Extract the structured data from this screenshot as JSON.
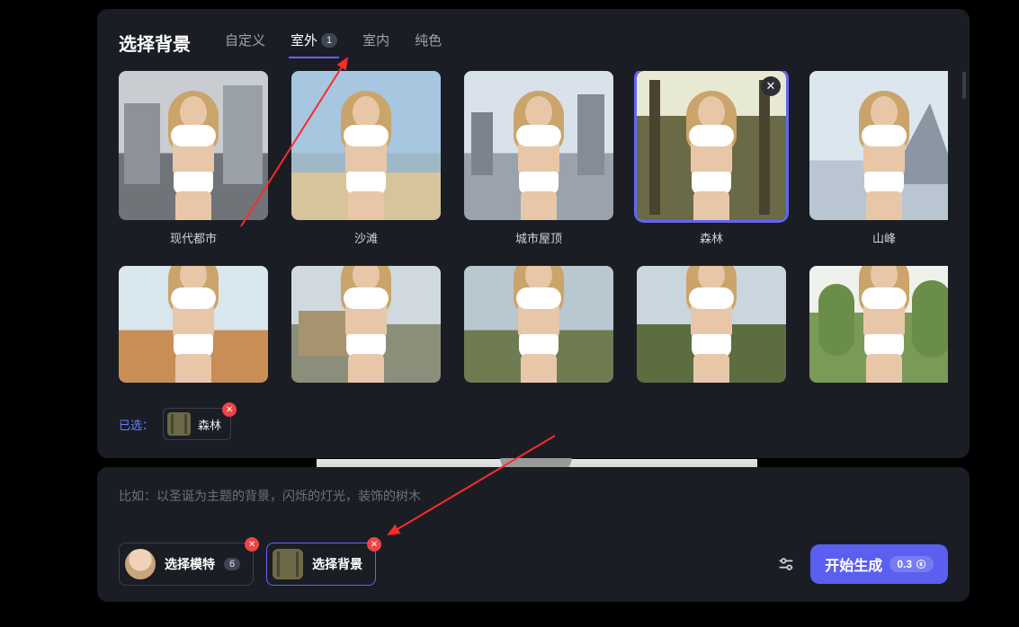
{
  "header": {
    "title": "选择背景",
    "tabs": [
      {
        "label": "自定义",
        "active": false,
        "badge": null
      },
      {
        "label": "室外",
        "active": true,
        "badge": "1"
      },
      {
        "label": "室内",
        "active": false,
        "badge": null
      },
      {
        "label": "纯色",
        "active": false,
        "badge": null
      }
    ]
  },
  "backgrounds_row1": [
    {
      "label": "现代都市",
      "bg": "bg-city",
      "selected": false
    },
    {
      "label": "沙滩",
      "bg": "bg-beach",
      "selected": false
    },
    {
      "label": "城市屋顶",
      "bg": "bg-roof",
      "selected": false
    },
    {
      "label": "森林",
      "bg": "bg-forest",
      "selected": true
    },
    {
      "label": "山峰",
      "bg": "bg-mountain",
      "selected": false
    }
  ],
  "backgrounds_row2": [
    {
      "bg": "bg-desert"
    },
    {
      "bg": "bg-farmhouse"
    },
    {
      "bg": "bg-field"
    },
    {
      "bg": "bg-vineyard"
    },
    {
      "bg": "bg-trees"
    }
  ],
  "selected": {
    "prefix": "已选：",
    "items": [
      {
        "label": "森林",
        "thumb": "forest"
      }
    ]
  },
  "prompt": {
    "placeholder": "比如：以圣诞为主题的背景，闪烁的灯光，装饰的树木"
  },
  "options": {
    "model": {
      "label": "选择模特",
      "count": "6"
    },
    "background": {
      "label": "选择背景"
    }
  },
  "generate": {
    "label": "开始生成",
    "cost": "0.3"
  }
}
